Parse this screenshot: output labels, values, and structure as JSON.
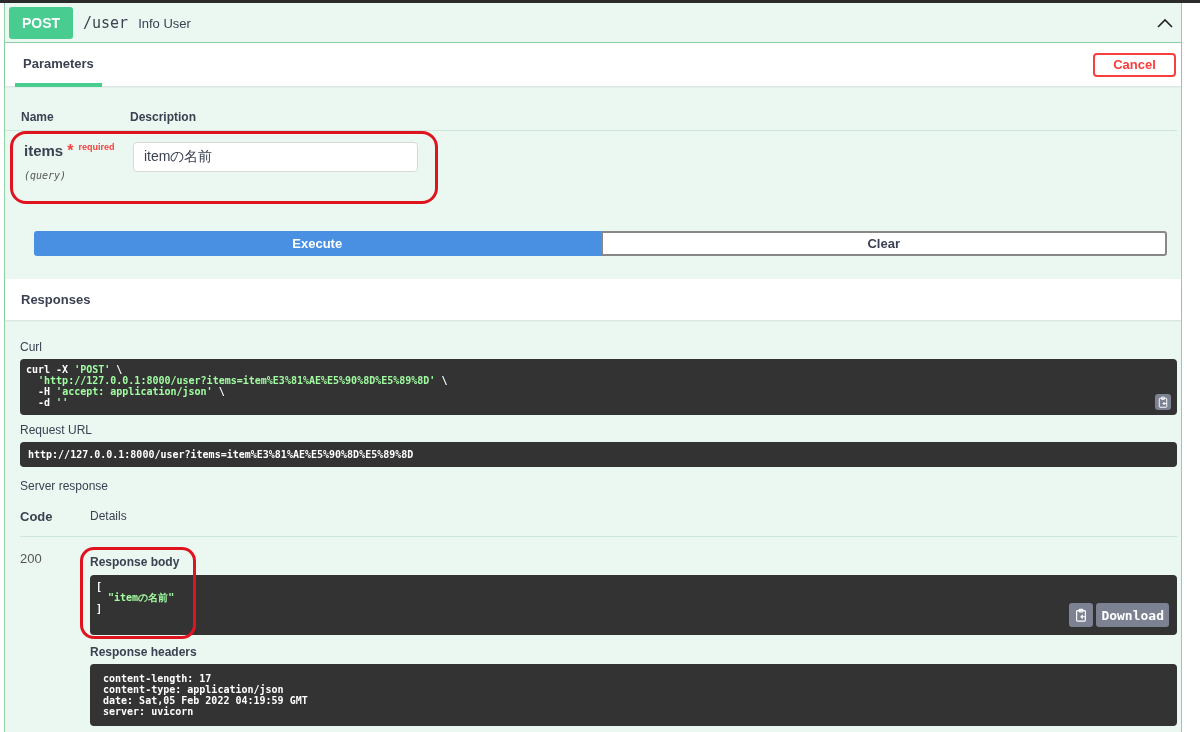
{
  "operation": {
    "method": "POST",
    "path": "/user",
    "summary": "Info User",
    "expanded": true
  },
  "parameters_tab": {
    "label": "Parameters",
    "selected": true
  },
  "cancel_button": "Cancel",
  "param_columns": [
    "Name",
    "Description"
  ],
  "parameters": [
    {
      "name": "items",
      "required_mark": "*",
      "required_label": "required",
      "location": "(query)",
      "value": "itemの名前",
      "highlighted": true
    }
  ],
  "actions": [
    {
      "label": "Execute",
      "kind": "primary"
    },
    {
      "label": "Clear",
      "kind": "secondary"
    }
  ],
  "responses_title": "Responses",
  "curl": {
    "label": "Curl",
    "lines": [
      [
        {
          "text": "curl -X ",
          "kind": "plain"
        },
        {
          "text": "'POST'",
          "kind": "string"
        },
        {
          "text": " \\",
          "kind": "plain"
        }
      ],
      [
        {
          "text": "  'http://127.0.0.1:8000/user?items=item%E3%81%AE%E5%90%8D%E5%89%8D'",
          "kind": "string"
        },
        {
          "text": " \\",
          "kind": "plain"
        }
      ],
      [
        {
          "text": "  -H ",
          "kind": "plain"
        },
        {
          "text": "'accept: application/json'",
          "kind": "string"
        },
        {
          "text": " \\",
          "kind": "plain"
        }
      ],
      [
        {
          "text": "  -d ",
          "kind": "plain"
        },
        {
          "text": "''",
          "kind": "string"
        }
      ]
    ]
  },
  "request_url": {
    "label": "Request URL",
    "value": "http://127.0.0.1:8000/user?items=item%E3%81%AE%E5%90%8D%E5%89%8D"
  },
  "server_response": {
    "label": "Server response",
    "columns": [
      "Code",
      "Details"
    ],
    "code": "200",
    "body": {
      "label": "Response body",
      "lines": [
        [
          {
            "text": "[",
            "kind": "plain"
          }
        ],
        [
          {
            "text": "  \"itemの名前\"",
            "kind": "string"
          }
        ],
        [
          {
            "text": "]",
            "kind": "plain"
          }
        ]
      ],
      "highlighted": true,
      "download": "Download"
    },
    "headers": {
      "label": "Response headers",
      "lines": [
        "content-length: 17",
        "content-type: application/json",
        "date: Sat,05 Feb 2022 04:19:59 GMT",
        "server: uvicorn"
      ]
    }
  }
}
